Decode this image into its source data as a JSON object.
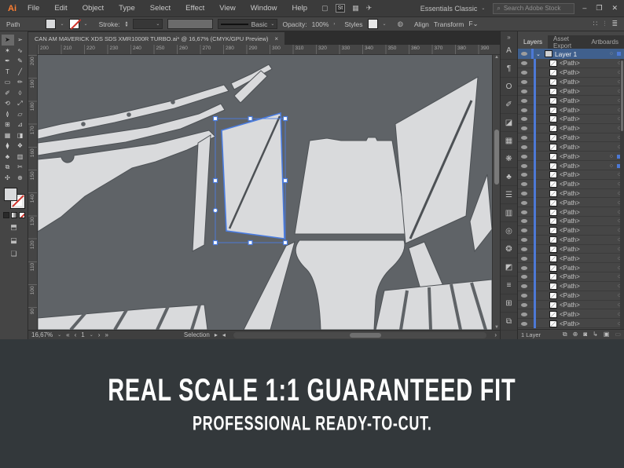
{
  "menu_bar": {
    "logo": "Ai",
    "items": [
      "File",
      "Edit",
      "Object",
      "Type",
      "Select",
      "Effect",
      "View",
      "Window",
      "Help"
    ],
    "right_icons": [
      {
        "name": "launcher-icon",
        "glyph": "▢"
      },
      {
        "name": "adobe-stock-icon",
        "glyph": "St"
      },
      {
        "name": "arrange-documents-icon",
        "glyph": "▦"
      },
      {
        "name": "share-icon",
        "glyph": "✈"
      }
    ],
    "workspace_label": "Essentials Classic",
    "search_placeholder": "Search Adobe Stock",
    "window_controls": {
      "minimize": "–",
      "maximize": "❐",
      "close": "✕"
    }
  },
  "control_bar": {
    "selection_label": "Path",
    "stroke_label": "Stroke:",
    "brush_label": "Basic",
    "opacity_label": "Opacity:",
    "opacity_value": "100%",
    "styles_label": "Styles",
    "align_label": "Align",
    "transform_label": "Transform",
    "ff_label": "F⌄"
  },
  "document_tab": {
    "title": "CAN AM MAVERICK XDS SDS XMR1000R TURBO.ai* @ 16,67% (CMYK/GPU Preview)",
    "close_glyph": "×"
  },
  "rulers": {
    "horizontal": [
      "200",
      "210",
      "220",
      "230",
      "240",
      "250",
      "260",
      "270",
      "280",
      "290",
      "300",
      "310",
      "320",
      "330",
      "340",
      "350",
      "360",
      "370",
      "380",
      "390"
    ],
    "vertical": [
      "200",
      "190",
      "180",
      "170",
      "160",
      "150",
      "140",
      "130",
      "120",
      "110",
      "100",
      "90"
    ]
  },
  "tools": [
    {
      "name": "selection-tool",
      "glyph": "➤",
      "selected": true
    },
    {
      "name": "direct-selection-tool",
      "glyph": "➢",
      "selected": false
    },
    {
      "name": "magic-wand-tool",
      "glyph": "✶",
      "selected": false
    },
    {
      "name": "lasso-tool",
      "glyph": "∿",
      "selected": false
    },
    {
      "name": "pen-tool",
      "glyph": "✒",
      "selected": false
    },
    {
      "name": "curvature-tool",
      "glyph": "✎",
      "selected": false
    },
    {
      "name": "type-tool",
      "glyph": "T",
      "selected": false
    },
    {
      "name": "line-segment-tool",
      "glyph": "╱",
      "selected": false
    },
    {
      "name": "rectangle-tool",
      "glyph": "▭",
      "selected": false
    },
    {
      "name": "paintbrush-tool",
      "glyph": "✏",
      "selected": false
    },
    {
      "name": "pencil-tool",
      "glyph": "✐",
      "selected": false
    },
    {
      "name": "eraser-tool",
      "glyph": "◊",
      "selected": false
    },
    {
      "name": "rotate-tool",
      "glyph": "⟲",
      "selected": false
    },
    {
      "name": "scale-tool",
      "glyph": "⤢",
      "selected": false
    },
    {
      "name": "width-tool",
      "glyph": "≬",
      "selected": false
    },
    {
      "name": "free-transform-tool",
      "glyph": "▱",
      "selected": false
    },
    {
      "name": "shape-builder-tool",
      "glyph": "⊞",
      "selected": false
    },
    {
      "name": "perspective-grid-tool",
      "glyph": "⊿",
      "selected": false
    },
    {
      "name": "mesh-tool",
      "glyph": "▦",
      "selected": false
    },
    {
      "name": "gradient-tool",
      "glyph": "◨",
      "selected": false
    },
    {
      "name": "eyedropper-tool",
      "glyph": "⧫",
      "selected": false
    },
    {
      "name": "blend-tool",
      "glyph": "❖",
      "selected": false
    },
    {
      "name": "symbol-sprayer-tool",
      "glyph": "♣",
      "selected": false
    },
    {
      "name": "column-graph-tool",
      "glyph": "▥",
      "selected": false
    },
    {
      "name": "artboard-tool",
      "glyph": "⧉",
      "selected": false
    },
    {
      "name": "slice-tool",
      "glyph": "✂",
      "selected": false
    },
    {
      "name": "hand-tool",
      "glyph": "✣",
      "selected": false
    },
    {
      "name": "zoom-tool",
      "glyph": "⊕",
      "selected": false
    }
  ],
  "right_panel": {
    "collapse_glyph": "»",
    "icon_strip": [
      {
        "name": "character-panel-icon",
        "glyph": "A"
      },
      {
        "name": "paragraph-panel-icon",
        "glyph": "¶"
      },
      {
        "name": "opentype-panel-icon",
        "glyph": "O"
      },
      {
        "name": "brushes-panel-icon",
        "glyph": "✐"
      },
      {
        "name": "graphic-styles-panel-icon",
        "glyph": "◪"
      },
      {
        "name": "swatches-panel-icon",
        "glyph": "▦"
      },
      {
        "name": "color-panel-icon",
        "glyph": "❋"
      },
      {
        "name": "symbols-panel-icon",
        "glyph": "♣"
      },
      {
        "name": "stroke-panel-icon",
        "glyph": "☰"
      },
      {
        "name": "gradient-panel-icon",
        "glyph": "▥"
      },
      {
        "name": "transparency-panel-icon",
        "glyph": "◎"
      },
      {
        "name": "color-guide-panel-icon",
        "glyph": "❂"
      },
      {
        "name": "appearance-panel-icon",
        "glyph": "◩"
      },
      {
        "name": "align-panel-icon",
        "glyph": "≡"
      },
      {
        "name": "transform-panel-icon",
        "glyph": "⊞"
      },
      {
        "name": "pathfinder-panel-icon",
        "glyph": "⧉"
      }
    ],
    "tabs": [
      {
        "label": "Layers",
        "active": true
      },
      {
        "label": "Asset Export",
        "active": false
      },
      {
        "label": "Artboards",
        "active": false
      }
    ],
    "layer_name": "Layer 1",
    "layer_chevron": "⌄",
    "path_label": "<Path>",
    "path_count": 29,
    "selected_path_indices": [
      10,
      11
    ],
    "target_glyph": "○",
    "footer_label": "1 Layer",
    "footer_icons": [
      {
        "name": "collect-for-export-icon",
        "glyph": "⧉",
        "dim": false
      },
      {
        "name": "locate-object-icon",
        "glyph": "⊕",
        "dim": false
      },
      {
        "name": "make-clipping-mask-icon",
        "glyph": "◙",
        "dim": false
      },
      {
        "name": "new-sublayer-icon",
        "glyph": "↳",
        "dim": false
      },
      {
        "name": "new-layer-icon",
        "glyph": "▣",
        "dim": false
      },
      {
        "name": "delete-selection-icon",
        "glyph": "▭",
        "dim": true
      }
    ]
  },
  "status_bar": {
    "zoom_value": "16,67%",
    "first_glyph": "«",
    "prev_glyph": "‹",
    "artboard_value": "1",
    "next_glyph": "›",
    "last_glyph": "»",
    "tool_label": "Selection",
    "right_arrow": "›"
  },
  "banner": {
    "line1": "REAL SCALE 1:1 GUARANTEED FIT",
    "line2": "PROFESSIONAL READY-TO-CUT."
  },
  "colors": {
    "accent_blue": "#4d79d6",
    "selection_blue": "#4a7ce0",
    "canvas_bg": "#5f6367",
    "artwork_fill": "#d9dadc",
    "artwork_line": "#4d5155",
    "banner_bg": "#33383b",
    "logo_orange": "#ff7f32"
  }
}
